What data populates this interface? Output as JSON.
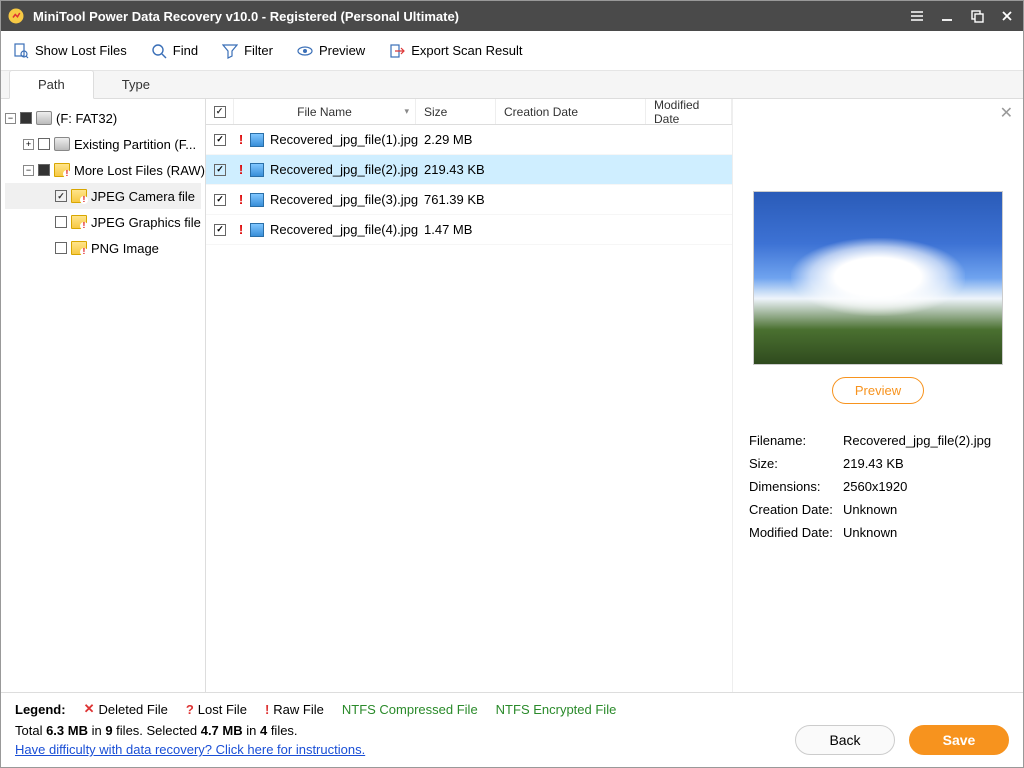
{
  "titlebar": {
    "title": "MiniTool Power Data Recovery v10.0 - Registered (Personal Ultimate)"
  },
  "toolbar": {
    "show_lost_files": "Show Lost Files",
    "find": "Find",
    "filter": "Filter",
    "preview": "Preview",
    "export_scan_result": "Export Scan Result"
  },
  "tabs": {
    "path": "Path",
    "type": "Type"
  },
  "tree": {
    "root": "(F: FAT32)",
    "existing_partition": "Existing Partition (F...",
    "more_lost_files": "More Lost Files (RAW)",
    "jpeg_camera": "JPEG Camera file",
    "jpeg_graphics": "JPEG Graphics file",
    "png_image": "PNG Image"
  },
  "columns": {
    "name": "File Name",
    "size": "Size",
    "cdate": "Creation Date",
    "mdate": "Modified Date"
  },
  "files": [
    {
      "name": "Recovered_jpg_file(1).jpg",
      "size": "2.29 MB",
      "checked": true,
      "selected": false
    },
    {
      "name": "Recovered_jpg_file(2).jpg",
      "size": "219.43 KB",
      "checked": true,
      "selected": true
    },
    {
      "name": "Recovered_jpg_file(3).jpg",
      "size": "761.39 KB",
      "checked": true,
      "selected": false
    },
    {
      "name": "Recovered_jpg_file(4).jpg",
      "size": "1.47 MB",
      "checked": true,
      "selected": false
    }
  ],
  "preview": {
    "button": "Preview",
    "filename_label": "Filename:",
    "filename": "Recovered_jpg_file(2).jpg",
    "size_label": "Size:",
    "size": "219.43 KB",
    "dimensions_label": "Dimensions:",
    "dimensions": "2560x1920",
    "cdate_label": "Creation Date:",
    "cdate": "Unknown",
    "mdate_label": "Modified Date:",
    "mdate": "Unknown"
  },
  "legend": {
    "label": "Legend:",
    "deleted": "Deleted File",
    "lost": "Lost File",
    "raw": "Raw File",
    "ntfs_compressed": "NTFS Compressed File",
    "ntfs_encrypted": "NTFS Encrypted File"
  },
  "stats": {
    "total_prefix": "Total ",
    "total_size": "6.3 MB",
    "in1": " in ",
    "total_files": "9",
    "files1": " files.  Selected ",
    "sel_size": "4.7 MB",
    "in2": " in ",
    "sel_files": "4",
    "files2": " files."
  },
  "help_link": "Have difficulty with data recovery? Click here for instructions.",
  "buttons": {
    "back": "Back",
    "save": "Save"
  }
}
